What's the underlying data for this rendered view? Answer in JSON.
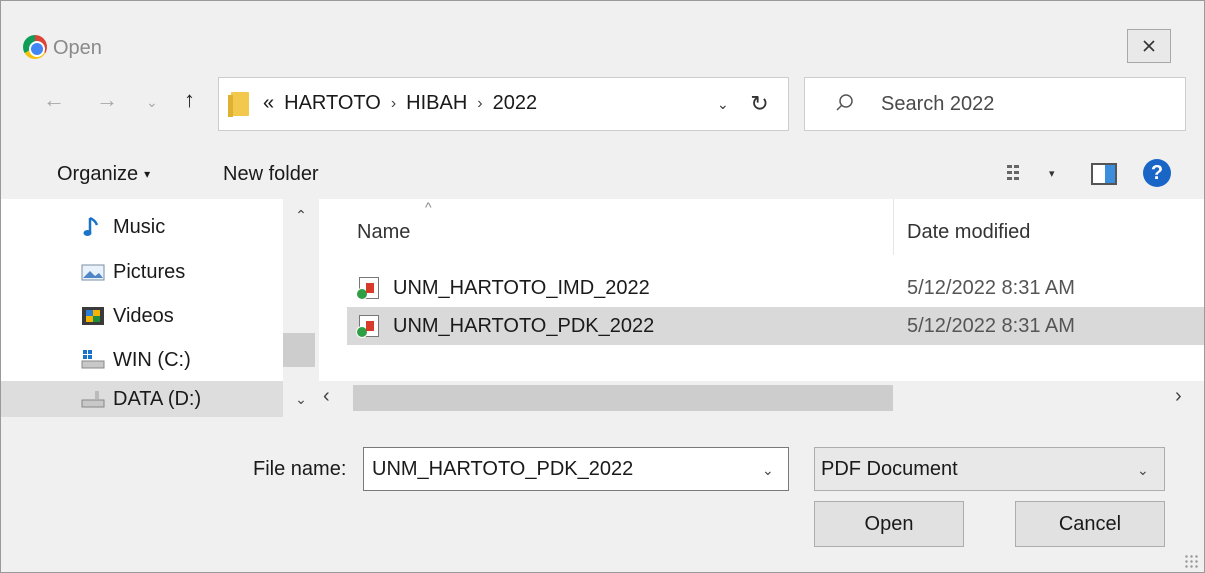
{
  "window": {
    "title": "Open"
  },
  "nav": {
    "back": "←",
    "forward": "→",
    "recent": "⌄",
    "up": "↑",
    "address": {
      "prefix": "«",
      "crumbs": [
        "HARTOTO",
        "HIBAH",
        "2022"
      ],
      "separator": "›",
      "dropdown": "⌄"
    },
    "refresh": "↻",
    "search": {
      "placeholder": "Search 2022"
    }
  },
  "toolbar": {
    "organize": "Organize",
    "organize_caret": "▾",
    "new_folder": "New folder",
    "view_caret": "▾",
    "help": "?"
  },
  "sidebar": {
    "items": [
      {
        "label": "Music",
        "icon": "music-icon"
      },
      {
        "label": "Pictures",
        "icon": "pictures-icon"
      },
      {
        "label": "Videos",
        "icon": "videos-icon"
      },
      {
        "label": "WIN (C:)",
        "icon": "drive-c-icon"
      },
      {
        "label": "DATA (D:)",
        "icon": "drive-d-icon",
        "selected": true
      }
    ],
    "scroll_up": "⌃",
    "scroll_down": "⌄"
  },
  "files": {
    "sort_arrow": "^",
    "columns": {
      "name": "Name",
      "date": "Date modified"
    },
    "rows": [
      {
        "name": "UNM_HARTOTO_IMD_2022",
        "date": "5/12/2022 8:31 AM",
        "selected": false
      },
      {
        "name": "UNM_HARTOTO_PDK_2022",
        "date": "5/12/2022 8:31 AM",
        "selected": true
      }
    ],
    "hscroll_left": "‹",
    "hscroll_right": "›"
  },
  "footer": {
    "filename_label": "File name:",
    "filename_value": "UNM_HARTOTO_PDK_2022",
    "filename_caret": "⌄",
    "filetype_value": "PDF Document",
    "filetype_caret": "⌄",
    "open_label": "Open",
    "cancel_label": "Cancel"
  },
  "colors": {
    "accent": "#1a66c7",
    "selection": "#d9d9d9",
    "background": "#f0f0f0"
  }
}
